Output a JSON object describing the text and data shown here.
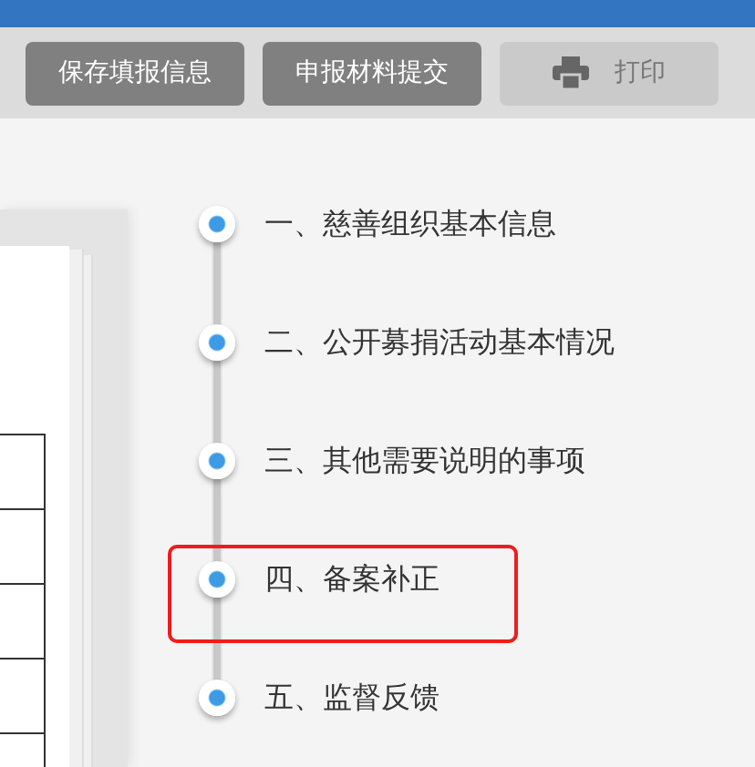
{
  "toolbar": {
    "buttons": [
      {
        "label": "保存填报信息",
        "kind": "text",
        "disabled": false
      },
      {
        "label": "申报材料提交",
        "kind": "text",
        "disabled": false
      },
      {
        "label": "打印",
        "kind": "print",
        "disabled": true
      }
    ]
  },
  "steps": [
    {
      "label": "一、慈善组织基本信息",
      "highlighted": false
    },
    {
      "label": "二、公开募捐活动基本情况",
      "highlighted": false
    },
    {
      "label": "三、其他需要说明的事项",
      "highlighted": false
    },
    {
      "label": "四、备案补正",
      "highlighted": true
    },
    {
      "label": "五、监督反馈",
      "highlighted": false
    }
  ]
}
